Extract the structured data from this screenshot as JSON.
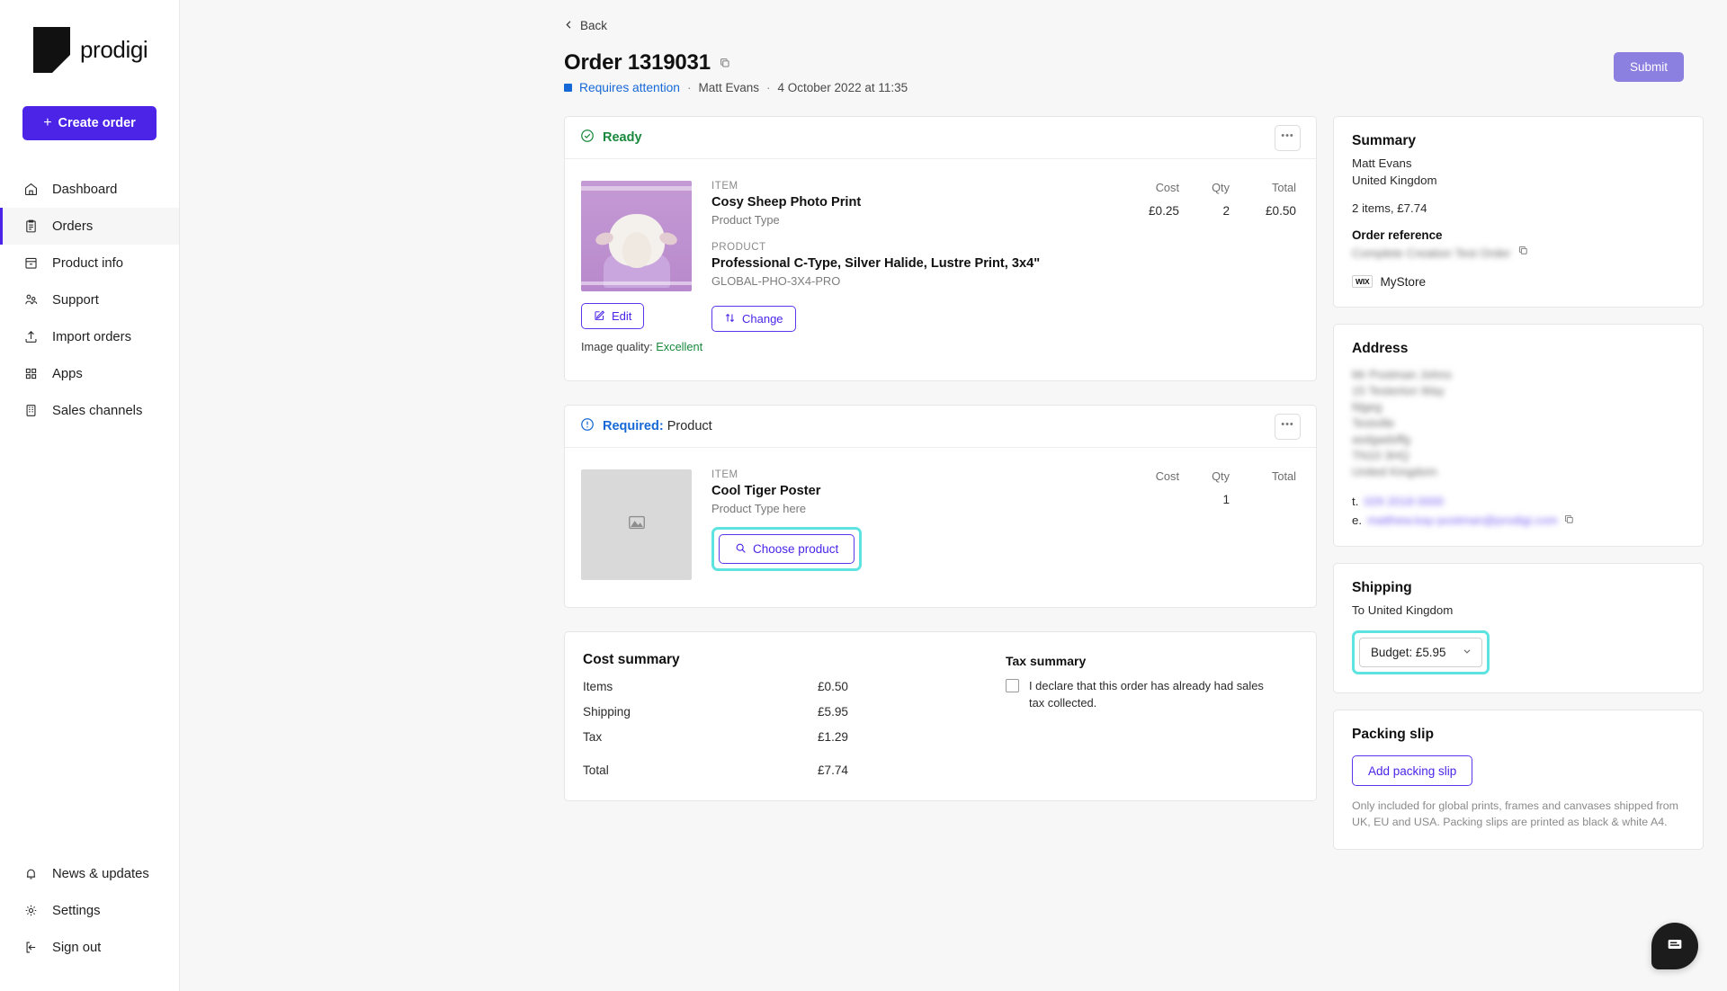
{
  "sidebar": {
    "brand": "prodigi",
    "create_order_label": "Create order",
    "create_order_plus": "+",
    "items": [
      {
        "label": "Dashboard",
        "icon": "home-icon",
        "active": false
      },
      {
        "label": "Orders",
        "icon": "clipboard-icon",
        "active": true
      },
      {
        "label": "Product info",
        "icon": "archive-icon",
        "active": false
      },
      {
        "label": "Support",
        "icon": "users-icon",
        "active": false
      },
      {
        "label": "Import orders",
        "icon": "upload-icon",
        "active": false
      },
      {
        "label": "Apps",
        "icon": "grid-icon",
        "active": false
      },
      {
        "label": "Sales channels",
        "icon": "building-icon",
        "active": false
      }
    ],
    "bottom_items": [
      {
        "label": "News & updates",
        "icon": "bell-icon"
      },
      {
        "label": "Settings",
        "icon": "gear-icon"
      },
      {
        "label": "Sign out",
        "icon": "sign-out-icon"
      }
    ]
  },
  "header": {
    "back_label": "Back",
    "title": "Order 1319031",
    "status": "Requires attention",
    "customer": "Matt Evans",
    "date": "4 October 2022 at 11:35",
    "separator": "·",
    "submit_label": "Submit"
  },
  "items_table_headers": {
    "cost": "Cost",
    "qty": "Qty",
    "total": "Total"
  },
  "item_cards": [
    {
      "status_label": "Ready",
      "status_kind": "ready",
      "thumb": "sheep-photo",
      "item_kicker": "ITEM",
      "item_name": "Cosy Sheep Photo Print",
      "item_type": "Product Type",
      "product_kicker": "PRODUCT",
      "product_name": "Professional C-Type, Silver Halide, Lustre Print, 3x4\"",
      "sku": "GLOBAL-PHO-3X4-PRO",
      "edit_label": "Edit",
      "change_label": "Change",
      "image_quality_label": "Image quality:",
      "image_quality_value": "Excellent",
      "cost": "£0.25",
      "qty": "2",
      "total": "£0.50"
    },
    {
      "status_label": "Required:",
      "status_suffix": " Product",
      "status_kind": "required",
      "thumb": "placeholder",
      "item_kicker": "ITEM",
      "item_name": "Cool Tiger Poster",
      "item_type": "Product Type here",
      "choose_product_label": "Choose product",
      "cost": "",
      "qty": "1",
      "total": ""
    }
  ],
  "cost_summary": {
    "title": "Cost summary",
    "rows": [
      {
        "label": "Items",
        "value": "£0.50"
      },
      {
        "label": "Shipping",
        "value": "£5.95"
      },
      {
        "label": "Tax",
        "value": "£1.29"
      }
    ],
    "total_label": "Total",
    "total_value": "£7.74",
    "tax_title": "Tax summary",
    "tax_checkbox_label": "I declare that this order has already had sales tax collected."
  },
  "summary_panel": {
    "title": "Summary",
    "customer": "Matt Evans",
    "country": "United Kingdom",
    "items_total": "2 items, £7.74",
    "reference_label": "Order reference",
    "reference_value": "Complete Creation Test Order",
    "store_badge": "WIX",
    "store_name": "MyStore"
  },
  "address_panel": {
    "title": "Address",
    "lines": [
      "Mr Postman Johns",
      "15 Testerton Way",
      "fdgeg",
      "Testville",
      "asdgadsffg",
      "TN10 3HQ",
      "United Kingdom"
    ],
    "phone_prefix": "t.",
    "phone": "029 2018 0000",
    "email_prefix": "e.",
    "email": "matthew.kay-postman@prodigi.com"
  },
  "shipping_panel": {
    "title": "Shipping",
    "destination": "To United Kingdom",
    "selected_option": "Budget: £5.95"
  },
  "packing_panel": {
    "title": "Packing slip",
    "button_label": "Add packing slip",
    "note": "Only included for global prints, frames and canvases shipped from UK, EU and USA. Packing slips are printed as black & white A4."
  },
  "colors": {
    "brand_purple": "#4b24e8",
    "submit_purple": "#8b7fe0",
    "status_blue": "#1668d6",
    "ready_green": "#17883c",
    "highlight_cyan": "#5de3e0"
  }
}
